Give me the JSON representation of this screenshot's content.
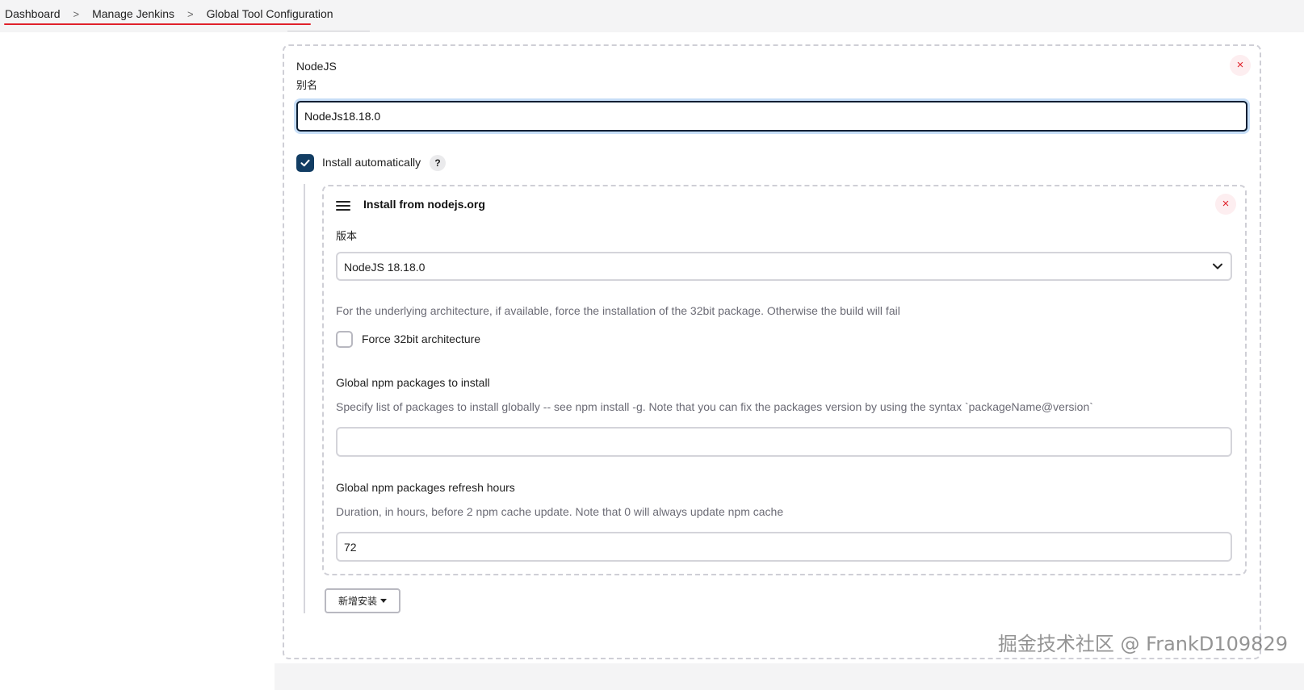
{
  "breadcrumb": {
    "items": [
      "Dashboard",
      "Manage Jenkins",
      "Global Tool Configuration"
    ],
    "separator": ">"
  },
  "tool": {
    "type_label": "NodeJS",
    "alias_label": "别名",
    "name_value": "NodeJs18.18.0"
  },
  "install_auto": {
    "label": "Install automatically",
    "checked": true,
    "help": "?"
  },
  "installer": {
    "title": "Install from nodejs.org",
    "version_label": "版本",
    "version_selected": "NodeJS 18.18.0",
    "arch_description": "For the underlying architecture, if available, force the installation of the 32bit package. Otherwise the build will fail",
    "arch_checkbox_label": "Force 32bit architecture",
    "arch_checked": false,
    "npm_packages_label": "Global npm packages to install",
    "npm_packages_description": "Specify list of packages to install globally -- see npm install -g. Note that you can fix the packages version by using the syntax `packageName@version`",
    "npm_packages_value": "",
    "refresh_label": "Global npm packages refresh hours",
    "refresh_description": "Duration, in hours, before 2 npm cache update. Note that 0 will always update npm cache",
    "refresh_value": "72"
  },
  "add_installer_button": "新增安装",
  "close_icon": "×",
  "watermark": "掘金技术社区 @ FrankD109829",
  "colors": {
    "accent_dark": "#123d63",
    "danger": "#e0212a",
    "focus_ring": "#c7def7"
  }
}
